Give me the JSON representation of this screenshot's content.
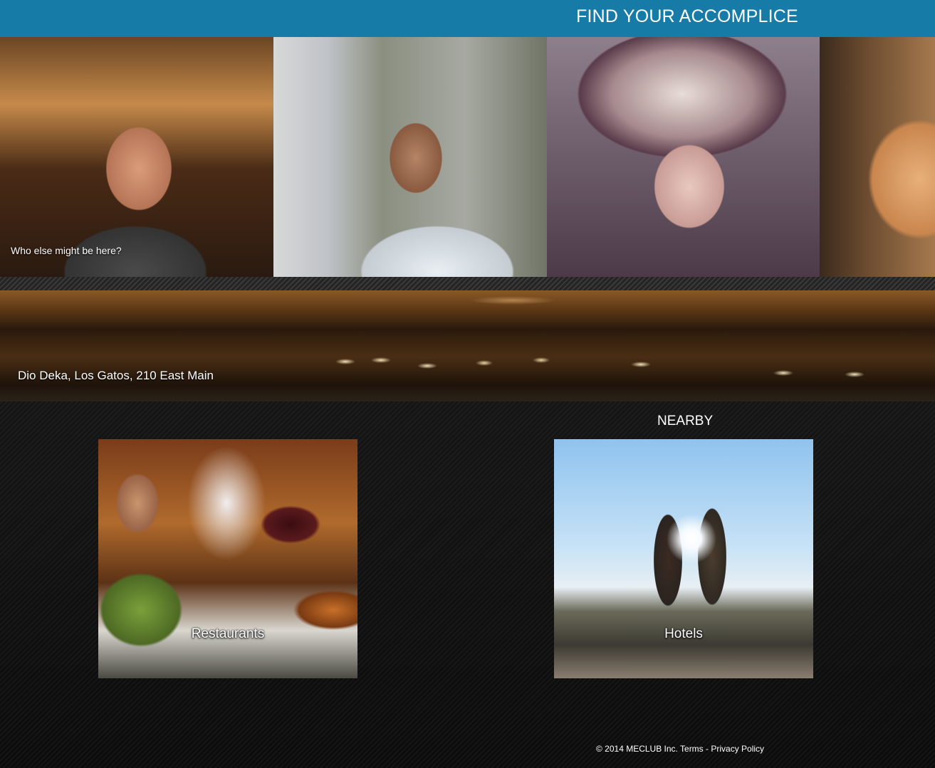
{
  "header": {
    "title": "FIND YOUR ACCOMPLICE"
  },
  "photos": {
    "caption": "Who else might be here?",
    "items": [
      {
        "name": "member-photo-1"
      },
      {
        "name": "member-photo-2"
      },
      {
        "name": "member-photo-3"
      },
      {
        "name": "member-photo-4"
      }
    ]
  },
  "venue": {
    "label": "Dio Deka, Los Gatos, 210 East Main"
  },
  "nearby": {
    "title": "NEARBY",
    "tiles": [
      {
        "label": "Restaurants"
      },
      {
        "label": "Hotels"
      }
    ]
  },
  "footer": {
    "copyright": "© 2014 MECLUB Inc.",
    "terms": "Terms",
    "separator": "-",
    "privacy": "Privacy Policy"
  },
  "colors": {
    "header_bg": "#177ba8",
    "page_bg": "#141414"
  }
}
